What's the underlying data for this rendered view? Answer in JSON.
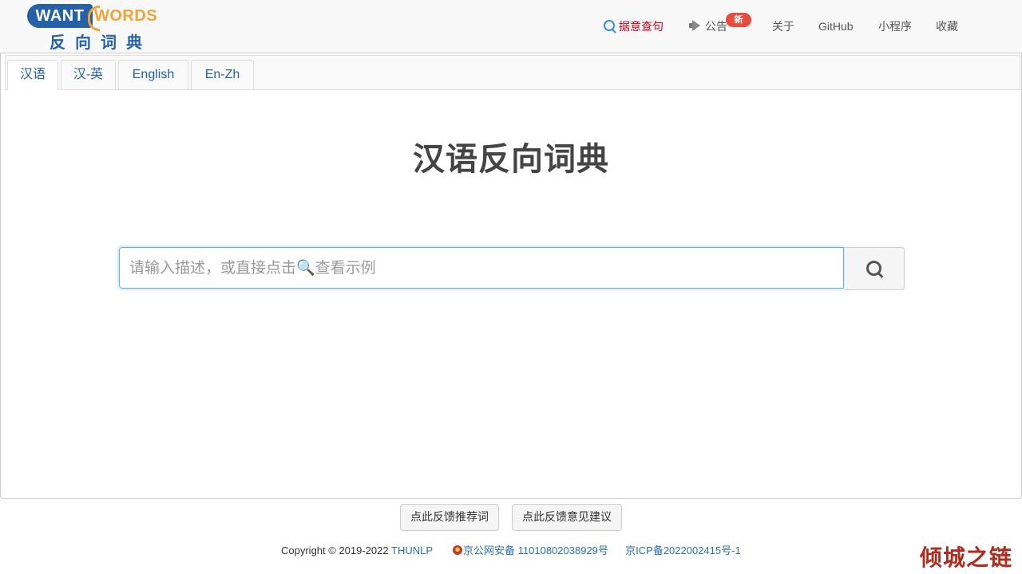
{
  "logo": {
    "want": "WANT",
    "words": "WORDS",
    "subtitle": "反向词典"
  },
  "nav": {
    "items": [
      {
        "label": "据意查句",
        "icon": "search-icon",
        "active": true
      },
      {
        "label": "公告",
        "icon": "megaphone-icon",
        "badge": "新"
      },
      {
        "label": "关于"
      },
      {
        "label": "GitHub"
      },
      {
        "label": "小程序"
      },
      {
        "label": "收藏"
      }
    ]
  },
  "tabs": [
    {
      "label": "汉语",
      "active": true
    },
    {
      "label": "汉-英"
    },
    {
      "label": "English"
    },
    {
      "label": "En-Zh"
    }
  ],
  "main": {
    "title": "汉语反向词典",
    "search": {
      "placeholder": "请输入描述，或直接点击🔍查看示例",
      "value": ""
    }
  },
  "feedback": {
    "recommend_label": "点此反馈推荐词",
    "suggestion_label": "点此反馈意见建议"
  },
  "footer": {
    "copyright": "Copyright © 2019-2022",
    "org_link": "THUNLP",
    "police_record": "京公网安备 11010802038929号",
    "icp_record": "京ICP备2022002415号-1"
  },
  "watermark": "倾城之链",
  "colors": {
    "brand_blue": "#2461a8",
    "brand_orange": "#f0a436",
    "active_red": "#d0021b",
    "badge_red": "#e74c3c"
  }
}
